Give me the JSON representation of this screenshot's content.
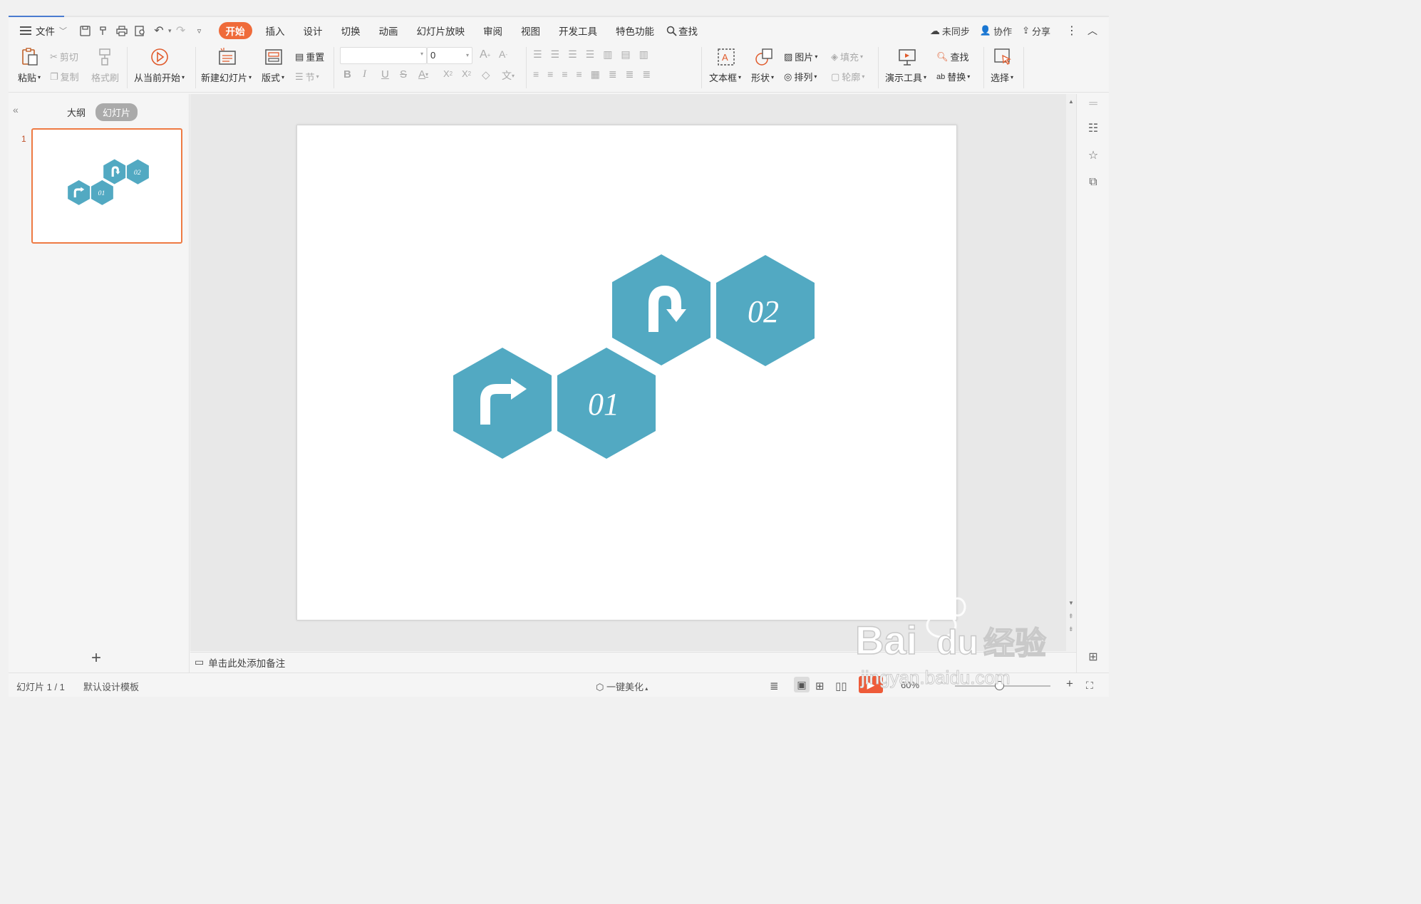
{
  "menu": {
    "file": "文件",
    "tabs": [
      "开始",
      "插入",
      "设计",
      "切换",
      "动画",
      "幻灯片放映",
      "审阅",
      "视图",
      "开发工具",
      "特色功能"
    ],
    "active_tab": "开始",
    "search": "查找",
    "sync": "未同步",
    "collab": "协作",
    "share": "分享"
  },
  "ribbon": {
    "paste": "粘贴",
    "cut": "剪切",
    "copy": "复制",
    "format_painter": "格式刷",
    "from_current": "从当前开始",
    "new_slide": "新建幻灯片",
    "layout": "版式",
    "reset": "重置",
    "section": "节",
    "font_size": "0",
    "textbox": "文本框",
    "shape": "形状",
    "picture": "图片",
    "fill": "填充",
    "arrange": "排列",
    "outline": "轮廓",
    "present_tools": "演示工具",
    "find": "查找",
    "replace": "替换",
    "select": "选择"
  },
  "left_panel": {
    "tab_outline": "大纲",
    "tab_slides": "幻灯片",
    "slide_number": "1"
  },
  "slide": {
    "hex_labels": [
      "01",
      "02"
    ],
    "hex_color": "#52a9c2"
  },
  "notes": {
    "placeholder": "单击此处添加备注"
  },
  "status": {
    "slide_count": "幻灯片 1 / 1",
    "template": "默认设计模板",
    "beautify": "一键美化",
    "zoom": "60%"
  },
  "watermark": {
    "text": "Bai du 经验",
    "url": "jingyan.baidu.com"
  }
}
